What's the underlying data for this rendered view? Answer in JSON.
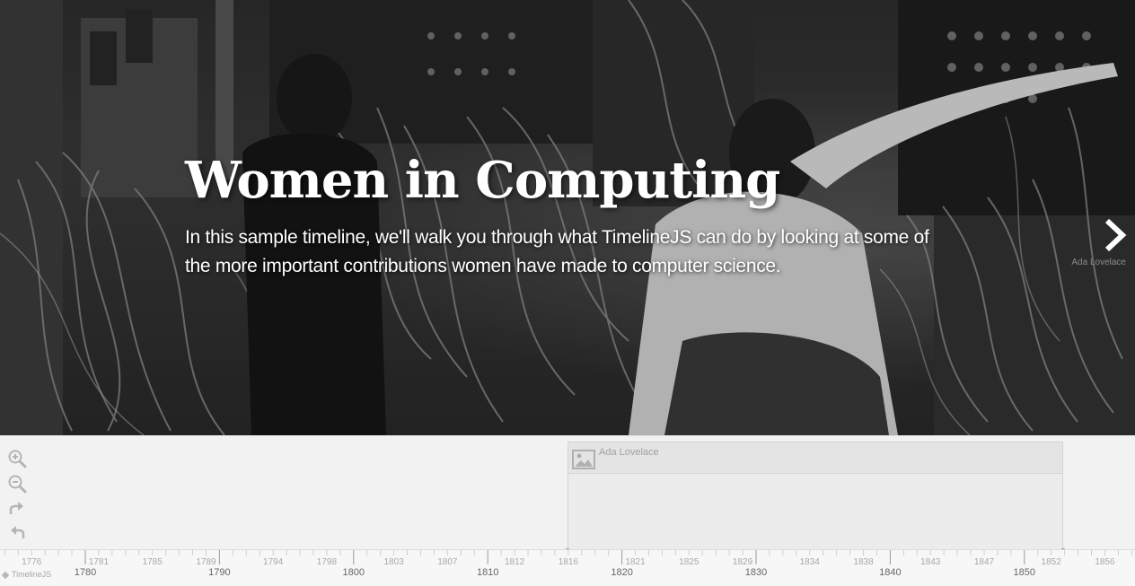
{
  "slide": {
    "title": "Women in Computing",
    "text": "In this sample timeline, we'll walk you through what TimelineJS can do by looking at some of the more important contributions women have made to computer science.",
    "next_label": "Ada Lovelace"
  },
  "toolbar": {
    "zoom_in_icon": "zoom-in-icon",
    "zoom_out_icon": "zoom-out-icon",
    "forward_icon": "forward-icon",
    "back_icon": "back-icon"
  },
  "era": {
    "title": "Ada Lovelace",
    "icon": "image-icon"
  },
  "axis": {
    "minor_labels": [
      "1776",
      "1781",
      "1785",
      "1789",
      "1794",
      "1798",
      "1803",
      "1807",
      "1812",
      "1816",
      "1821",
      "1825",
      "1829",
      "1834",
      "1838",
      "1843",
      "1847",
      "1852",
      "1856"
    ],
    "major_labels": [
      "1780",
      "1790",
      "1800",
      "1810",
      "1820",
      "1830",
      "1840",
      "1850"
    ]
  },
  "brand": {
    "label": "TimelineJS"
  },
  "colors": {
    "accent": "#ffffff",
    "panel": "#f2f2f2",
    "muted_text": "#a0a0a0"
  }
}
